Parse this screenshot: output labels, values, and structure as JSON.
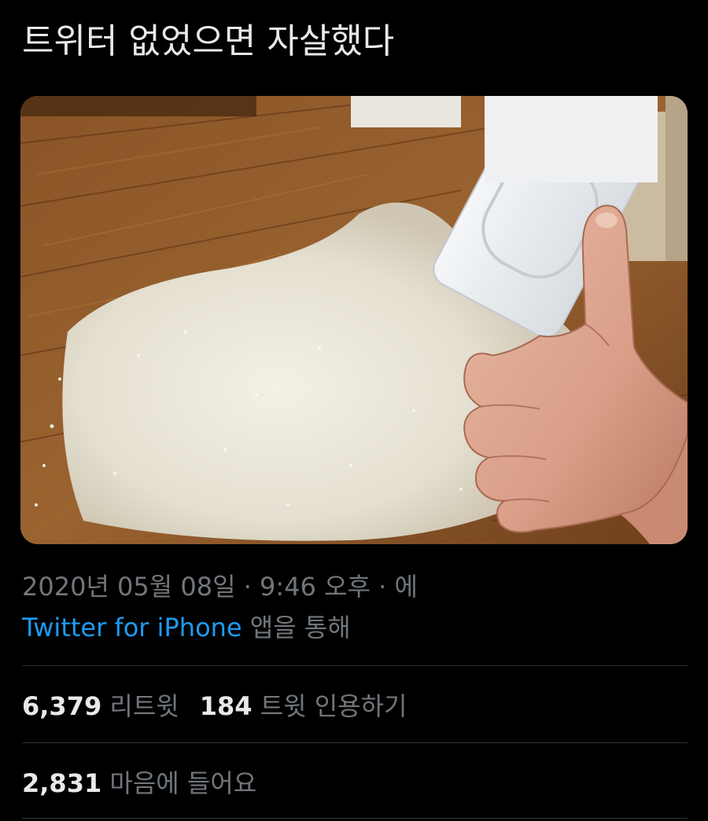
{
  "tweet": {
    "text": "트위터 없었으면 자살했다",
    "image_alt": "thumbs-up hand next to spilled rice on a wooden floor"
  },
  "meta": {
    "timestamp": "2020년 05월 08일 · 9:46 오후 · 에",
    "source_app": "Twitter for iPhone",
    "source_suffix": " 앱을 통해"
  },
  "stats": {
    "retweets_count": "6,379",
    "retweets_label": " 리트윗",
    "quotes_count": "184",
    "quotes_label": " 트윗 인용하기",
    "likes_count": "2,831",
    "likes_label": " 마음에 들어요"
  },
  "colors": {
    "background": "#000000",
    "text_primary": "#e7e9ea",
    "text_secondary": "#71767b",
    "link": "#1d9bf0",
    "divider": "#2f3336"
  }
}
